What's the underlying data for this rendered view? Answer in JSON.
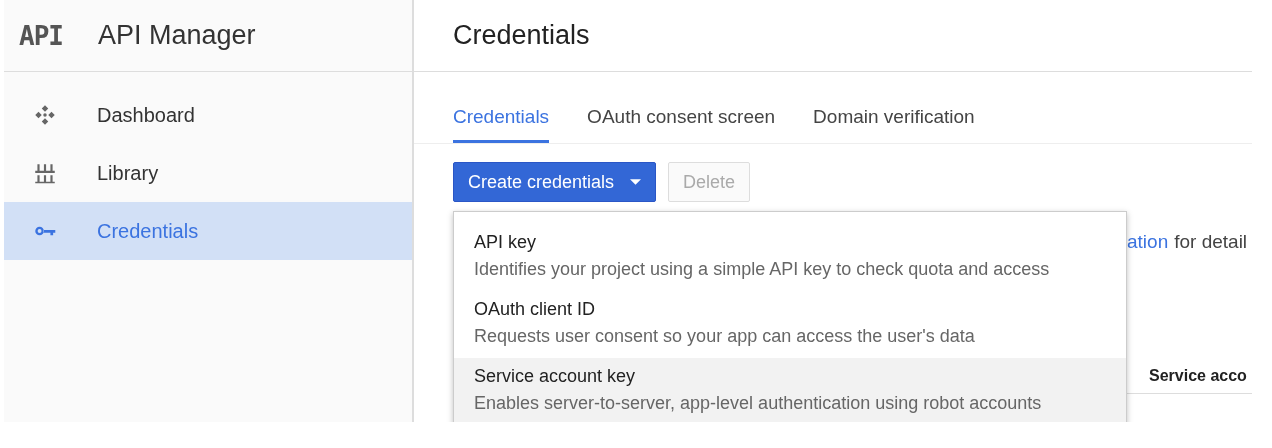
{
  "sidebar": {
    "logo": "API",
    "title": "API Manager",
    "items": [
      {
        "label": "Dashboard",
        "kind": "dashboard",
        "selected": false
      },
      {
        "label": "Library",
        "kind": "library",
        "selected": false
      },
      {
        "label": "Credentials",
        "kind": "key",
        "selected": true
      }
    ]
  },
  "main": {
    "title": "Credentials",
    "tabs": [
      {
        "label": "Credentials",
        "selected": true
      },
      {
        "label": "OAuth consent screen",
        "selected": false
      },
      {
        "label": "Domain verification",
        "selected": false
      }
    ],
    "buttons": [
      {
        "label": "Create credentials",
        "kind": "dropdown",
        "disabled": false
      },
      {
        "label": "Delete",
        "kind": "plain",
        "disabled": true
      }
    ],
    "hint": {
      "link": "ation",
      "text": "for detail"
    },
    "column_header": "Service acco",
    "menu": [
      {
        "title": "API key",
        "description": "Identifies your project using a simple API key to check quota and access",
        "selected": false
      },
      {
        "title": "OAuth client ID",
        "description": "Requests user consent so your app can access the user's data",
        "selected": false
      },
      {
        "title": "Service account key",
        "description": "Enables server-to-server, app-level authentication using robot accounts",
        "selected": true
      }
    ]
  }
}
